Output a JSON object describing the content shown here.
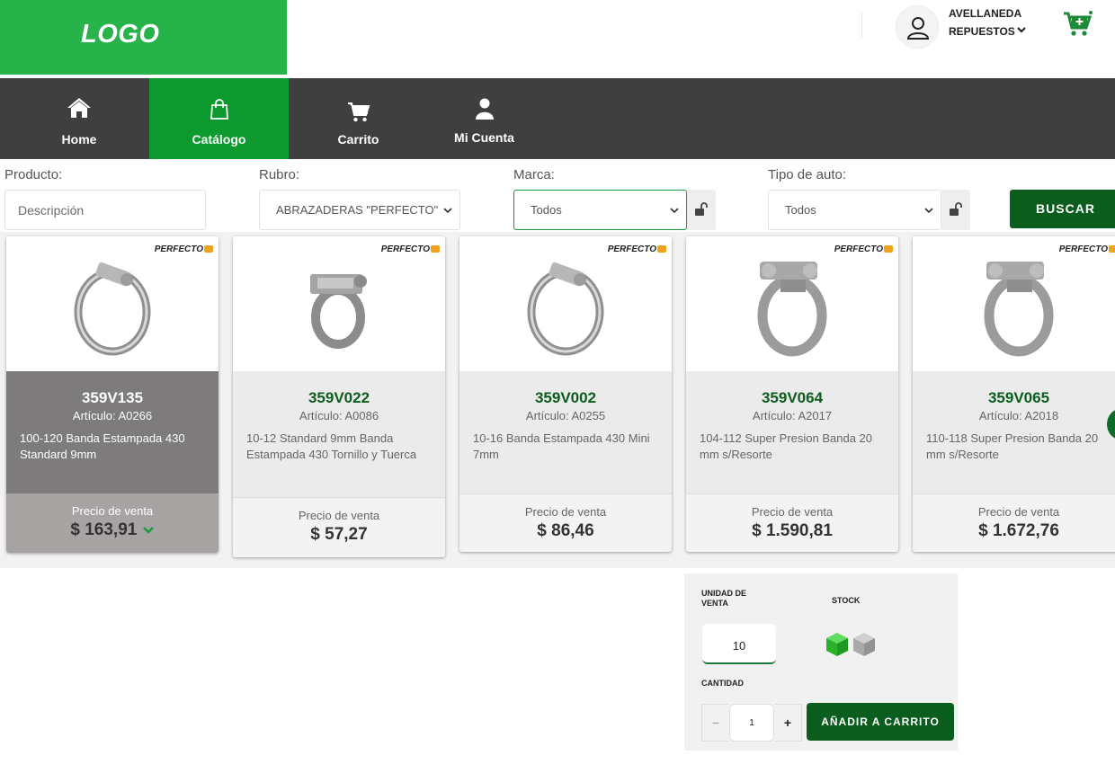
{
  "header": {
    "logo": "LOGO",
    "user_line1": "AVELLANEDA",
    "user_line2": "REPUESTOS",
    "accent": "#27b24a"
  },
  "nav": {
    "items": [
      {
        "label": "Home",
        "icon": "home-icon"
      },
      {
        "label": "Catálogo",
        "icon": "shopping-bag-icon",
        "active": true
      },
      {
        "label": "Carrito",
        "icon": "cart-icon"
      },
      {
        "label": "Mi Cuenta",
        "icon": "user-icon"
      }
    ]
  },
  "filters": {
    "producto_label": "Producto:",
    "producto_placeholder": "Descripción",
    "rubro_label": "Rubro:",
    "rubro_value": "ABRAZADERAS \"PERFECTO\"",
    "marca_label": "Marca:",
    "marca_value": "Todos",
    "tipo_label": "Tipo de auto:",
    "tipo_value": "Todos",
    "search_label": "BUSCAR"
  },
  "products": [
    {
      "brand": "PERFECTO",
      "code": "359V135",
      "article": "Artículo: A0266",
      "description": "100-120 Banda Estampada 430 Standard 9mm",
      "price_label": "Precio de venta",
      "price": "$ 163,91",
      "selected": true
    },
    {
      "brand": "PERFECTO",
      "code": "359V022",
      "article": "Artículo: A0086",
      "description": "10-12 Standard 9mm Banda Estampada 430 Tornillo y Tuerca",
      "price_label": "Precio de venta",
      "price": "$ 57,27"
    },
    {
      "brand": "PERFECTO",
      "code": "359V002",
      "article": "Artículo: A0255",
      "description": "10-16 Banda Estampada 430 Mini 7mm",
      "price_label": "Precio de venta",
      "price": "$ 86,46"
    },
    {
      "brand": "PERFECTO",
      "code": "359V064",
      "article": "Artículo: A2017",
      "description": "104-112 Super Presion Banda 20 mm s/Resorte",
      "price_label": "Precio de venta",
      "price": "$ 1.590,81"
    },
    {
      "brand": "PERFECTO",
      "code": "359V065",
      "article": "Artículo: A2018",
      "description": "110-118 Super Presion Banda 20 mm s/Resorte",
      "price_label": "Precio de venta",
      "price": "$ 1.672,76"
    }
  ],
  "panel": {
    "unit_label": "UNIDAD DE VENTA",
    "unit_value": "10",
    "stock_label": "STOCK",
    "quantity_label": "CANTIDAD",
    "quantity_value": "1",
    "minus": "−",
    "plus": "+",
    "add_label": "AÑADIR A CARRITO",
    "stock_available_color": "#2bc22f",
    "stock_empty_color": "#a9a9a9"
  }
}
